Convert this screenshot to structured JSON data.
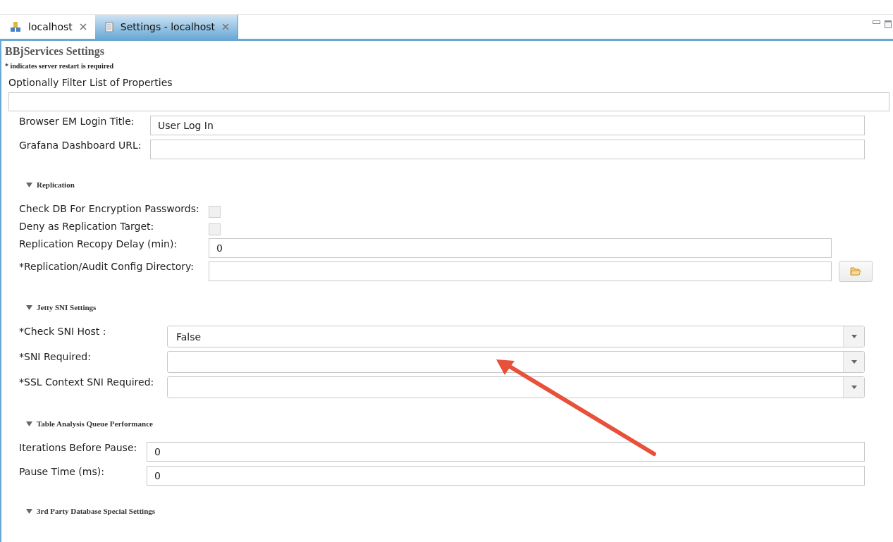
{
  "tabs": [
    {
      "label": "localhost",
      "selected": false
    },
    {
      "label": "Settings - localhost",
      "selected": true
    }
  ],
  "page": {
    "title": "BBjServices Settings",
    "note": "* indicates server restart is required",
    "filter": {
      "label": "Optionally Filter List of Properties"
    }
  },
  "sections": [
    {
      "fields": [
        {
          "kind": "text",
          "label": "Browser EM Login Title:",
          "value": "User Log In"
        },
        {
          "kind": "text",
          "label": "Grafana Dashboard URL:"
        }
      ]
    },
    {
      "header": "Replication",
      "expanded": true,
      "fields": [
        {
          "kind": "checkbox",
          "label": "Check DB For Encryption Passwords:",
          "checked": false
        },
        {
          "kind": "checkbox",
          "label": "Deny as Replication Target:",
          "checked": false
        },
        {
          "kind": "text",
          "label": "Replication Recopy Delay (min):",
          "value": "0"
        },
        {
          "kind": "directory",
          "label": "*Replication/Audit Config Directory:"
        }
      ]
    },
    {
      "header": "Jetty SNI Settings",
      "expanded": true,
      "fields": [
        {
          "kind": "select",
          "label": "*Check SNI Host :",
          "value": "False"
        },
        {
          "kind": "select",
          "label": "*SNI Required:"
        },
        {
          "kind": "select",
          "label": "*SSL Context SNI Required:"
        }
      ]
    },
    {
      "header": "Table Analysis Queue Performance",
      "expanded": true,
      "fields": [
        {
          "kind": "text",
          "label": "Iterations Before Pause:",
          "value": "0"
        },
        {
          "kind": "text",
          "label": "Pause Time (ms):",
          "value": "0"
        }
      ]
    },
    {
      "header": "3rd Party Database Special Settings",
      "expanded": true
    }
  ]
}
